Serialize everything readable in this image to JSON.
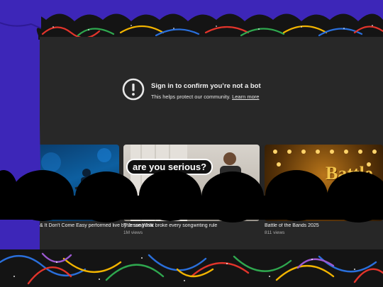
{
  "alert": {
    "title": "Sign in to confirm you’re not a bot",
    "subtitle": "This helps protect our community.",
    "learn_more": "Learn more",
    "icon": "warning-circle-icon"
  },
  "videos": [
    {
      "title": "& It Don't Come Easy performed live by Jesse Welles ...",
      "views": "",
      "badge": ""
    },
    {
      "title": "The song that broke every songwriting rule",
      "views": "1M views",
      "overlay_text": "are you serious?"
    },
    {
      "title": "Battle of the Bands 2025",
      "views": "811 views",
      "thumb_text": "Battle"
    }
  ],
  "colors": {
    "curtain": "#3d26b8",
    "player_bg": "#272727",
    "text": "#f1f1f1",
    "subtext": "#aaaaaa"
  }
}
